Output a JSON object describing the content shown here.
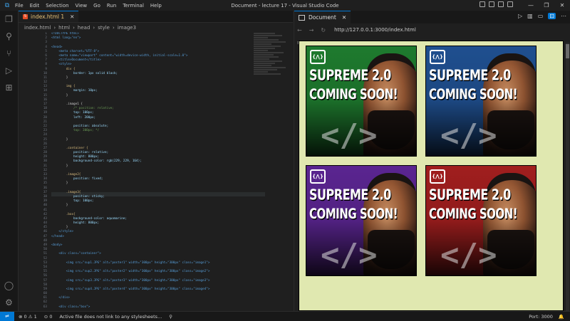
{
  "window": {
    "title": "Document - lecture 17 - Visual Studio Code",
    "menu": [
      "File",
      "Edit",
      "Selection",
      "View",
      "Go",
      "Run",
      "Terminal",
      "Help"
    ]
  },
  "editor": {
    "tab_label": "index.html 1",
    "breadcrumbs": [
      "index.html",
      "html",
      "head",
      "style",
      "image3"
    ],
    "line_numbers": [
      "1",
      "2",
      "3",
      "4",
      "5",
      "6",
      "7",
      "8",
      "9",
      "10",
      "11",
      "12",
      "13",
      "14",
      "15",
      "16",
      "17",
      "18",
      "19",
      "20",
      "21",
      "22",
      "23",
      "24",
      "25",
      "26",
      "27",
      "28",
      "29",
      "30",
      "31",
      "32",
      "33",
      "34",
      "35",
      "36",
      "37",
      "38",
      "39",
      "40",
      "41",
      "42",
      "43",
      "44",
      "45",
      "46",
      "47",
      "48",
      "49",
      "50",
      "51",
      "52",
      "53",
      "54",
      "55",
      "56",
      "57",
      "58",
      "59",
      "60",
      "61",
      "62",
      "63"
    ],
    "code_lines": [
      "<!DOCTYPE html>",
      "<html lang=\"en\">",
      "",
      "<head>",
      "    <meta charset=\"UTF-8\">",
      "    <meta name=\"viewport\" content=\"width=device-width, initial-scale=1.0\">",
      "    <title>Document</title>",
      "    <style>",
      "        div {",
      "            border: 1px solid black;",
      "        }",
      "",
      "        img {",
      "            margin: 10px;",
      "        }",
      "",
      "        .image1 {",
      "            /* position: relative;",
      "            top: 100px;",
      "            left: 200px;",
      "",
      "            position: absolute;",
      "            top: 300px; */",
      "",
      "        }",
      "",
      "        .container {",
      "            position: relative;",
      "            height: 800px;",
      "            background-color: rgb(229, 229, 164);",
      "        }",
      "",
      "        .image2{",
      "            position: fixed;",
      "        }",
      "",
      "        .image3{",
      "            position: sticky;",
      "            top: 100px;",
      "        }",
      "",
      "        .box{",
      "            background-color: aquamarine;",
      "            height: 800px;",
      "        }",
      "    </style>",
      "</head>",
      "",
      "<body>",
      "",
      "    <div class=\"container\">",
      "",
      "        <img src=\"sup1.JPG\" alt=\"poster1\" width=\"300px\" height=\"300px\" class=\"image1\">",
      "",
      "        <img src=\"sup2.JPG\" alt=\"poster2\" width=\"300px\" height=\"300px\" class=\"image2\">",
      "",
      "        <img src=\"sup3.JPG\" alt=\"poster3\" width=\"300px\" height=\"300px\" class=\"image3\">",
      "",
      "        <img src=\"sup4.JPG\" alt=\"poster4\" width=\"300px\" height=\"300px\" class=\"image4\">",
      "",
      "    </div>",
      "",
      "    <div class=\"box\">"
    ]
  },
  "preview": {
    "tab_label": "Document",
    "url": "http://127.0.0.1:3000/index.html",
    "posters": [
      {
        "headline": "SUPREME 2.0",
        "subline": "COMING SOON!",
        "logo": "{⋀}",
        "color": "#1e7a2e"
      },
      {
        "headline": "SUPREME 2.0",
        "subline": "COMING SOON!",
        "logo": "{⋀}",
        "color": "#1f4f8f"
      },
      {
        "headline": "SUPREME 2.0",
        "subline": "COMING SOON!",
        "logo": "{⋀}",
        "color": "#5a2590"
      },
      {
        "headline": "SUPREME 2.0",
        "subline": "COMING SOON!",
        "logo": "{⋀}",
        "color": "#a01e1e"
      }
    ],
    "background_color": "#e0e8b0"
  },
  "status": {
    "errors": "0",
    "warnings": "1",
    "ports": "0",
    "message": "Active file does not link to any stylesheets...",
    "port": "Port: 3000"
  }
}
